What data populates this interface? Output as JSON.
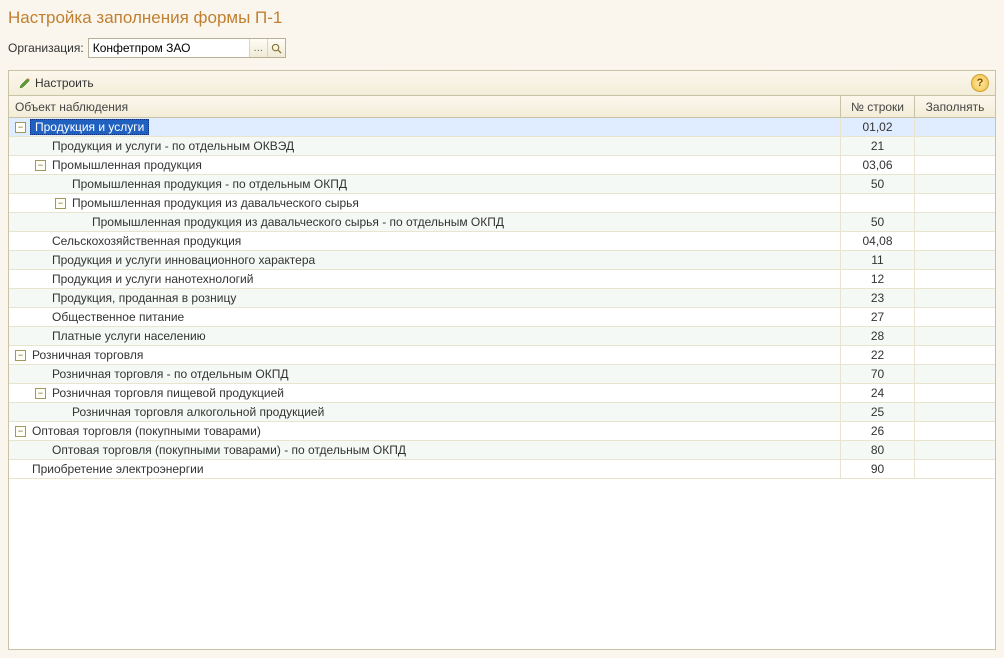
{
  "page_title": "Настройка заполнения формы П-1",
  "org_label": "Организация:",
  "org_value": "Конфетпром ЗАО",
  "toolbar": {
    "configure_label": "Настроить",
    "help_tooltip": "?"
  },
  "columns": {
    "object": "Объект наблюдения",
    "line": "№ строки",
    "fill": "Заполнять"
  },
  "rows": [
    {
      "level": 0,
      "expand": "minus",
      "selected": true,
      "label": "Продукция и услуги",
      "line": "01,02",
      "alt": false
    },
    {
      "level": 1,
      "expand": "none",
      "selected": false,
      "label": "Продукция и услуги - по отдельным ОКВЭД",
      "line": "21",
      "alt": true
    },
    {
      "level": 1,
      "expand": "minus",
      "selected": false,
      "label": "Промышленная продукция",
      "line": "03,06",
      "alt": false
    },
    {
      "level": 2,
      "expand": "none",
      "selected": false,
      "label": "Промышленная продукция - по отдельным ОКПД",
      "line": "50",
      "alt": true
    },
    {
      "level": 2,
      "expand": "minus",
      "selected": false,
      "label": "Промышленная продукция из давальческого сырья",
      "line": "",
      "alt": false
    },
    {
      "level": 3,
      "expand": "none",
      "selected": false,
      "label": "Промышленная продукция из давальческого сырья - по отдельным ОКПД",
      "line": "50",
      "alt": true
    },
    {
      "level": 1,
      "expand": "none",
      "selected": false,
      "label": "Сельскохозяйственная продукция",
      "line": "04,08",
      "alt": false
    },
    {
      "level": 1,
      "expand": "none",
      "selected": false,
      "label": "Продукция и услуги инновационного характера",
      "line": "11",
      "alt": true
    },
    {
      "level": 1,
      "expand": "none",
      "selected": false,
      "label": "Продукция и услуги нанотехнологий",
      "line": "12",
      "alt": false
    },
    {
      "level": 1,
      "expand": "none",
      "selected": false,
      "label": "Продукция, проданная в розницу",
      "line": "23",
      "alt": true
    },
    {
      "level": 1,
      "expand": "none",
      "selected": false,
      "label": "Общественное питание",
      "line": "27",
      "alt": false
    },
    {
      "level": 1,
      "expand": "none",
      "selected": false,
      "label": "Платные услуги населению",
      "line": "28",
      "alt": true
    },
    {
      "level": 0,
      "expand": "minus",
      "selected": false,
      "label": "Розничная торговля",
      "line": "22",
      "alt": false
    },
    {
      "level": 1,
      "expand": "none",
      "selected": false,
      "label": "Розничная торговля - по отдельным ОКПД",
      "line": "70",
      "alt": true
    },
    {
      "level": 1,
      "expand": "minus",
      "selected": false,
      "label": "Розничная торговля пищевой продукцией",
      "line": "24",
      "alt": false
    },
    {
      "level": 2,
      "expand": "none",
      "selected": false,
      "label": "Розничная торговля алкогольной продукцией",
      "line": "25",
      "alt": true
    },
    {
      "level": 0,
      "expand": "minus",
      "selected": false,
      "label": "Оптовая торговля (покупными товарами)",
      "line": "26",
      "alt": false
    },
    {
      "level": 1,
      "expand": "none",
      "selected": false,
      "label": "Оптовая торговля (покупными товарами) - по отдельным ОКПД",
      "line": "80",
      "alt": true
    },
    {
      "level": 0,
      "expand": "none",
      "selected": false,
      "label": "Приобретение электроэнергии",
      "line": "90",
      "alt": false
    }
  ]
}
